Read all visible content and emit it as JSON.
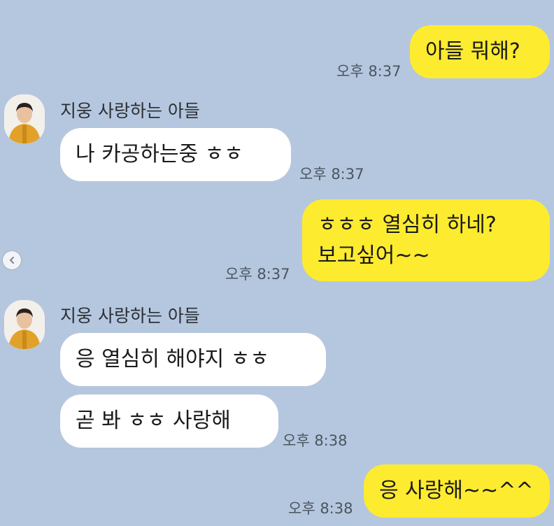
{
  "chat": {
    "messages": [
      {
        "sender": "me",
        "text": "아들 뭐해?",
        "time": "오후 8:37"
      },
      {
        "sender": "them",
        "name": "지웅 사랑하는 아들",
        "text": "나 카공하는중 ㅎㅎ",
        "time": "오후 8:37"
      },
      {
        "sender": "me",
        "lines": [
          "ㅎㅎㅎ 열심히 하네?",
          "보고싶어~~"
        ],
        "time": "오후 8:37"
      },
      {
        "sender": "them",
        "name": "지웅 사랑하는 아들",
        "text": "응 열심히 해야지 ㅎㅎ"
      },
      {
        "sender": "them",
        "text": "곧 봐 ㅎㅎ 사랑해",
        "time": "오후 8:38"
      },
      {
        "sender": "me",
        "text": "응 사랑해~~^^",
        "time": "오후 8:38"
      }
    ]
  },
  "icons": {
    "scroll_button": "chevron-left-icon",
    "avatar": "profile-photo"
  },
  "colors": {
    "background": "#b5c7de",
    "my_bubble": "#fdeb30",
    "their_bubble": "#ffffff",
    "time_text": "#4b5560"
  }
}
